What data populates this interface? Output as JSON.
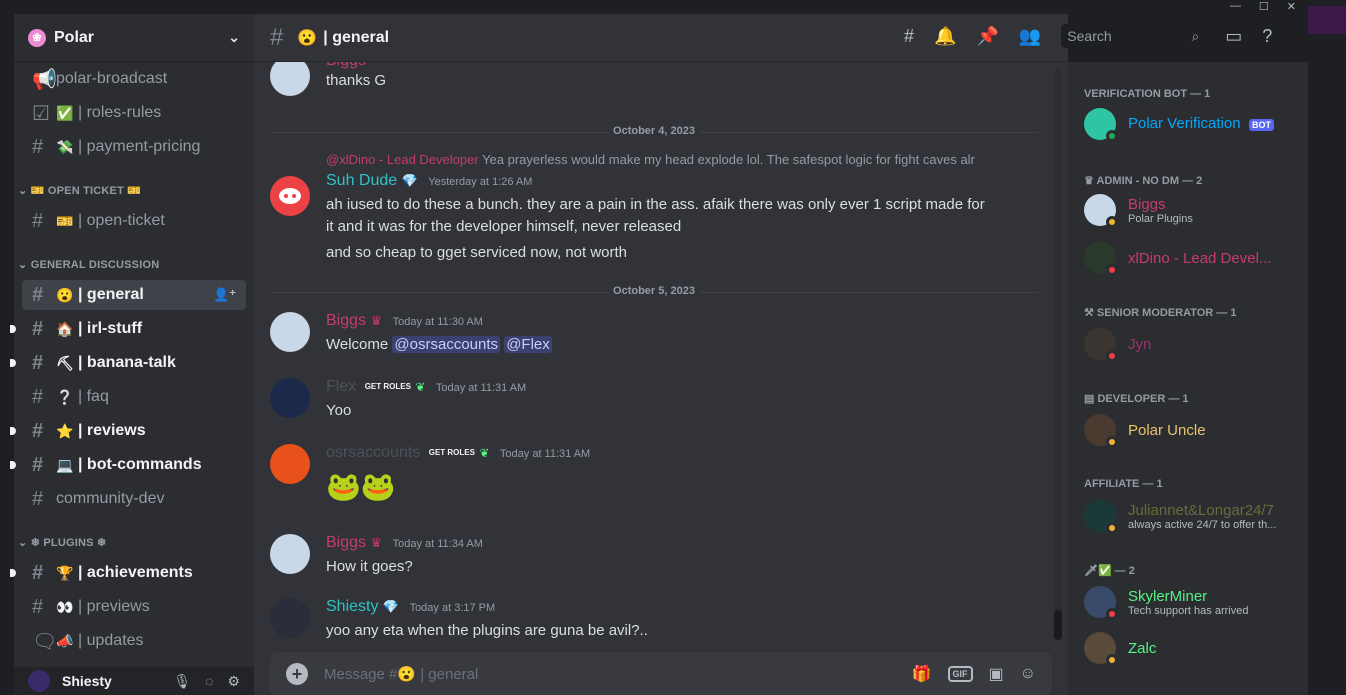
{
  "server": {
    "name": "Polar"
  },
  "sidebar": {
    "channels": [
      {
        "label": "polar-broadcast",
        "emoji": ""
      },
      {
        "label": "| roles-rules",
        "emoji": "✅"
      },
      {
        "label": "| payment-pricing",
        "emoji": "💸"
      },
      {
        "label": "| open-ticket",
        "emoji": "🎫"
      },
      {
        "label": "| general",
        "emoji": "😮"
      },
      {
        "label": "| irl-stuff",
        "emoji": "🏠"
      },
      {
        "label": "| banana-talk",
        "emoji": "⛏"
      },
      {
        "label": "| faq",
        "emoji": "❔"
      },
      {
        "label": "| reviews",
        "emoji": "⭐"
      },
      {
        "label": "| bot-commands",
        "emoji": "💻"
      },
      {
        "label": "community-dev",
        "emoji": ""
      },
      {
        "label": "| achievements",
        "emoji": "🏆"
      },
      {
        "label": "| previews",
        "emoji": "👀"
      },
      {
        "label": "| updates",
        "emoji": "📣"
      }
    ],
    "categories": {
      "open_ticket": "OPEN TICKET",
      "general_discussion": "GENERAL DISCUSSION",
      "plugins": "PLUGINS"
    },
    "user": {
      "name": "Shiesty"
    }
  },
  "header": {
    "channel_emoji": "😮",
    "channel_title": "| general",
    "search_placeholder": "Search"
  },
  "messages": {
    "top_partial": {
      "author": "Biggs",
      "text": "thanks G"
    },
    "date1": "October 4, 2023",
    "reply": {
      "reply_author": "@xlDino - Lead Developer",
      "reply_text": "Yea prayerless would make my head explode lol. The safespot logic for fight caves alr",
      "author": "Suh Dude",
      "time": "Yesterday at 1:26 AM",
      "text1": "ah iused to do these a bunch. they are a pain in the ass. afaik there was only ever 1 script made for",
      "text2": "it and it was for the developer himself, never released",
      "text3": "and so cheap to gget serviced now, not worth"
    },
    "date2": "October 5, 2023",
    "m1": {
      "author": "Biggs",
      "time": "Today at 11:30 AM",
      "text": "Welcome",
      "mention1": "@osrsaccounts",
      "mention2": "@Flex"
    },
    "m2": {
      "author": "Flex",
      "time": "Today at 11:31 AM",
      "text": "Yoo",
      "badge": "GET ROLES"
    },
    "m3": {
      "author": "osrsaccounts",
      "time": "Today at 11:31 AM",
      "badge": "GET ROLES"
    },
    "m4": {
      "author": "Biggs",
      "time": "Today at 11:34 AM",
      "text": "How it goes?"
    },
    "m5": {
      "author": "Shiesty",
      "time": "Today at 3:17 PM",
      "text": "yoo any eta when the plugins are guna be avil?.."
    }
  },
  "composer": {
    "placeholder": "Message #",
    "placeholder_suffix": "| general",
    "gif": "GIF"
  },
  "members": {
    "roles": [
      "VERIFICATION BOT — 1",
      "ADMIN - NO DM — 2",
      "SENIOR MODERATOR — 1",
      "DEVELOPER — 1",
      "AFFILIATE — 1",
      "— 2"
    ],
    "list": [
      {
        "name": "Polar Verification",
        "sub": "",
        "bot": "BOT"
      },
      {
        "name": "Biggs",
        "sub": "Polar Plugins"
      },
      {
        "name": "xlDino - Lead Devel...",
        "sub": ""
      },
      {
        "name": "Jyn",
        "sub": ""
      },
      {
        "name": "Polar Uncle",
        "sub": ""
      },
      {
        "name": "Juliannet&Longar24/7",
        "sub": "always active 24/7 to offer th..."
      },
      {
        "name": "SkylerMiner",
        "sub": "Tech support has arrived"
      },
      {
        "name": "Zalc",
        "sub": ""
      }
    ]
  },
  "colors": {
    "accent": "#5865f2",
    "biggs": "#c33d6c",
    "cyan": "#2ec4c4",
    "green": "#57f287",
    "gold": "#e8c46a"
  }
}
